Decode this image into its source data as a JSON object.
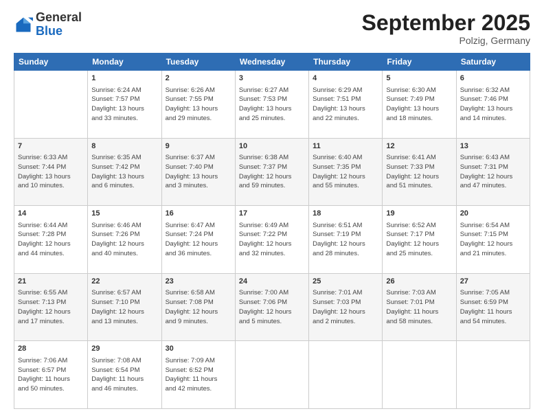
{
  "logo": {
    "general": "General",
    "blue": "Blue"
  },
  "header": {
    "month": "September 2025",
    "location": "Polzig, Germany"
  },
  "weekdays": [
    "Sunday",
    "Monday",
    "Tuesday",
    "Wednesday",
    "Thursday",
    "Friday",
    "Saturday"
  ],
  "weeks": [
    [
      {
        "day": "",
        "info": ""
      },
      {
        "day": "1",
        "info": "Sunrise: 6:24 AM\nSunset: 7:57 PM\nDaylight: 13 hours\nand 33 minutes."
      },
      {
        "day": "2",
        "info": "Sunrise: 6:26 AM\nSunset: 7:55 PM\nDaylight: 13 hours\nand 29 minutes."
      },
      {
        "day": "3",
        "info": "Sunrise: 6:27 AM\nSunset: 7:53 PM\nDaylight: 13 hours\nand 25 minutes."
      },
      {
        "day": "4",
        "info": "Sunrise: 6:29 AM\nSunset: 7:51 PM\nDaylight: 13 hours\nand 22 minutes."
      },
      {
        "day": "5",
        "info": "Sunrise: 6:30 AM\nSunset: 7:49 PM\nDaylight: 13 hours\nand 18 minutes."
      },
      {
        "day": "6",
        "info": "Sunrise: 6:32 AM\nSunset: 7:46 PM\nDaylight: 13 hours\nand 14 minutes."
      }
    ],
    [
      {
        "day": "7",
        "info": "Sunrise: 6:33 AM\nSunset: 7:44 PM\nDaylight: 13 hours\nand 10 minutes."
      },
      {
        "day": "8",
        "info": "Sunrise: 6:35 AM\nSunset: 7:42 PM\nDaylight: 13 hours\nand 6 minutes."
      },
      {
        "day": "9",
        "info": "Sunrise: 6:37 AM\nSunset: 7:40 PM\nDaylight: 13 hours\nand 3 minutes."
      },
      {
        "day": "10",
        "info": "Sunrise: 6:38 AM\nSunset: 7:37 PM\nDaylight: 12 hours\nand 59 minutes."
      },
      {
        "day": "11",
        "info": "Sunrise: 6:40 AM\nSunset: 7:35 PM\nDaylight: 12 hours\nand 55 minutes."
      },
      {
        "day": "12",
        "info": "Sunrise: 6:41 AM\nSunset: 7:33 PM\nDaylight: 12 hours\nand 51 minutes."
      },
      {
        "day": "13",
        "info": "Sunrise: 6:43 AM\nSunset: 7:31 PM\nDaylight: 12 hours\nand 47 minutes."
      }
    ],
    [
      {
        "day": "14",
        "info": "Sunrise: 6:44 AM\nSunset: 7:28 PM\nDaylight: 12 hours\nand 44 minutes."
      },
      {
        "day": "15",
        "info": "Sunrise: 6:46 AM\nSunset: 7:26 PM\nDaylight: 12 hours\nand 40 minutes."
      },
      {
        "day": "16",
        "info": "Sunrise: 6:47 AM\nSunset: 7:24 PM\nDaylight: 12 hours\nand 36 minutes."
      },
      {
        "day": "17",
        "info": "Sunrise: 6:49 AM\nSunset: 7:22 PM\nDaylight: 12 hours\nand 32 minutes."
      },
      {
        "day": "18",
        "info": "Sunrise: 6:51 AM\nSunset: 7:19 PM\nDaylight: 12 hours\nand 28 minutes."
      },
      {
        "day": "19",
        "info": "Sunrise: 6:52 AM\nSunset: 7:17 PM\nDaylight: 12 hours\nand 25 minutes."
      },
      {
        "day": "20",
        "info": "Sunrise: 6:54 AM\nSunset: 7:15 PM\nDaylight: 12 hours\nand 21 minutes."
      }
    ],
    [
      {
        "day": "21",
        "info": "Sunrise: 6:55 AM\nSunset: 7:13 PM\nDaylight: 12 hours\nand 17 minutes."
      },
      {
        "day": "22",
        "info": "Sunrise: 6:57 AM\nSunset: 7:10 PM\nDaylight: 12 hours\nand 13 minutes."
      },
      {
        "day": "23",
        "info": "Sunrise: 6:58 AM\nSunset: 7:08 PM\nDaylight: 12 hours\nand 9 minutes."
      },
      {
        "day": "24",
        "info": "Sunrise: 7:00 AM\nSunset: 7:06 PM\nDaylight: 12 hours\nand 5 minutes."
      },
      {
        "day": "25",
        "info": "Sunrise: 7:01 AM\nSunset: 7:03 PM\nDaylight: 12 hours\nand 2 minutes."
      },
      {
        "day": "26",
        "info": "Sunrise: 7:03 AM\nSunset: 7:01 PM\nDaylight: 11 hours\nand 58 minutes."
      },
      {
        "day": "27",
        "info": "Sunrise: 7:05 AM\nSunset: 6:59 PM\nDaylight: 11 hours\nand 54 minutes."
      }
    ],
    [
      {
        "day": "28",
        "info": "Sunrise: 7:06 AM\nSunset: 6:57 PM\nDaylight: 11 hours\nand 50 minutes."
      },
      {
        "day": "29",
        "info": "Sunrise: 7:08 AM\nSunset: 6:54 PM\nDaylight: 11 hours\nand 46 minutes."
      },
      {
        "day": "30",
        "info": "Sunrise: 7:09 AM\nSunset: 6:52 PM\nDaylight: 11 hours\nand 42 minutes."
      },
      {
        "day": "",
        "info": ""
      },
      {
        "day": "",
        "info": ""
      },
      {
        "day": "",
        "info": ""
      },
      {
        "day": "",
        "info": ""
      }
    ]
  ]
}
